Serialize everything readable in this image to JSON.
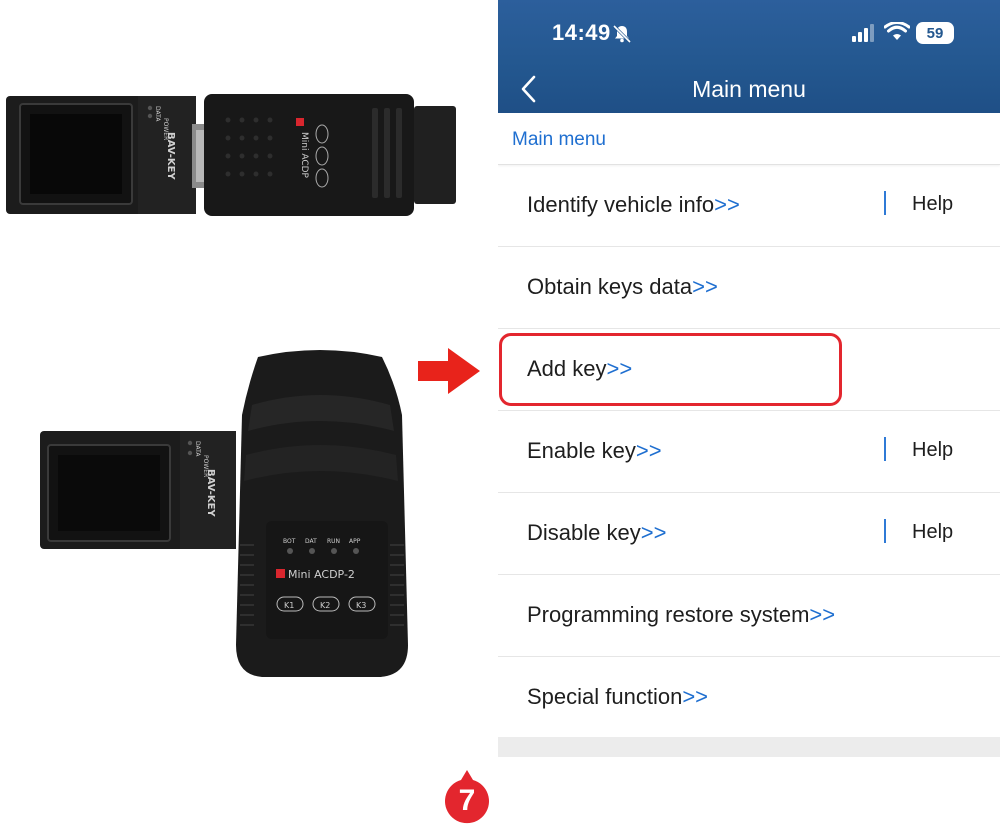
{
  "colors": {
    "header_blue": "#23578f",
    "link_blue": "#1f6fd0",
    "highlight_red": "#e3262e",
    "badge_red": "#e3262e"
  },
  "devices": {
    "top": {
      "adapter_brand": "BAV-KEY",
      "adapter_leds": [
        "DATA",
        "POWER"
      ],
      "programmer_label": "Mini ACDP"
    },
    "bottom": {
      "adapter_brand": "BAV-KEY",
      "adapter_leds": [
        "DATA",
        "POWER"
      ],
      "programmer_label": "Mini ACDP-2",
      "status_leds": [
        "BOT",
        "DAT",
        "RUN",
        "APP"
      ],
      "keys": [
        "K1",
        "K2",
        "K3"
      ]
    }
  },
  "status_bar": {
    "time": "14:49",
    "battery": "59",
    "icons": [
      "mute-bell-icon",
      "signal-icon",
      "wifi-icon",
      "battery-icon"
    ]
  },
  "nav": {
    "back_icon": "chevron-left-icon",
    "title": "Main menu"
  },
  "breadcrumb": "Main menu",
  "menu": {
    "chevron": ">>",
    "help_label": "Help",
    "items": [
      {
        "label": "Identify vehicle info",
        "has_help": true
      },
      {
        "label": "Obtain keys data",
        "has_help": false
      },
      {
        "label": "Add key",
        "has_help": false,
        "highlighted": true
      },
      {
        "label": "Enable key",
        "has_help": true
      },
      {
        "label": "Disable key",
        "has_help": true
      },
      {
        "label": "Programming restore system",
        "has_help": false
      },
      {
        "label": "Special function",
        "has_help": false
      }
    ]
  },
  "step_badge": "7"
}
